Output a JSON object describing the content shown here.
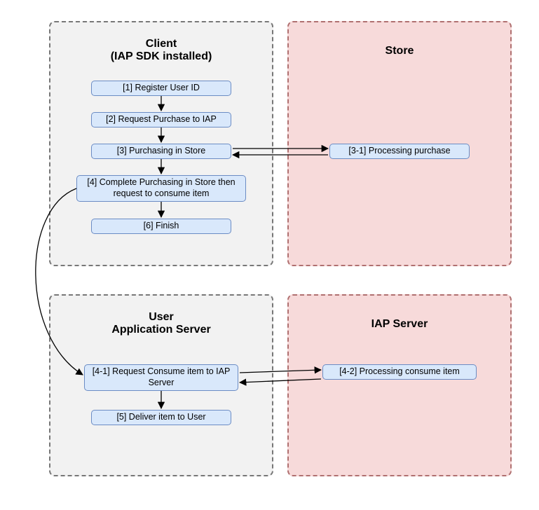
{
  "panels": {
    "client": {
      "title_l1": "Client",
      "title_l2": "(IAP SDK installed)"
    },
    "store": {
      "title": "Store"
    },
    "user_server": {
      "title_l1": "User",
      "title_l2": "Application Server"
    },
    "iap_server": {
      "title": "IAP Server"
    }
  },
  "nodes": {
    "n1": "[1] Register User ID",
    "n2": "[2] Request Purchase to IAP",
    "n3": "[3] Purchasing in Store",
    "n3_1": "[3-1] Processing purchase",
    "n4": "[4] Complete Purchasing in Store then request to consume item",
    "n6": "[6] Finish",
    "n4_1": "[4-1] Request Consume item to IAP Server",
    "n4_2": "[4-2] Processing consume item",
    "n5": "[5] Deliver item to User"
  }
}
